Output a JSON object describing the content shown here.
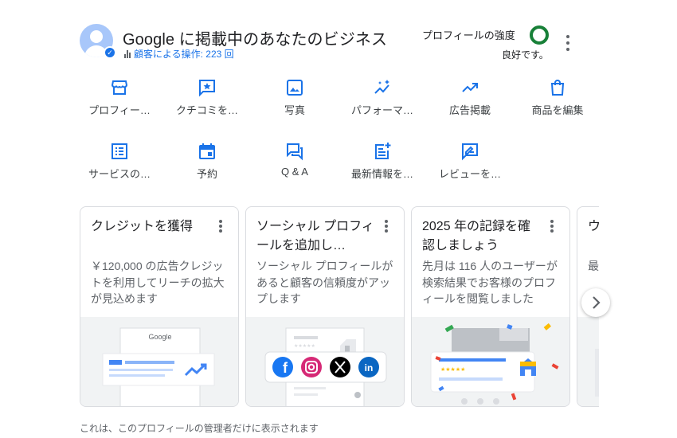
{
  "header": {
    "title": "Google に掲載中のあなたのビジネス",
    "interactions": "顧客による操作: 223 回",
    "profile_strength_label": "プロフィールの強度",
    "profile_strength_status": "良好です。",
    "accent_color": "#1a73e8",
    "strength_color": "#188038"
  },
  "actions": [
    {
      "icon": "storefront-icon",
      "label": "プロフィー…"
    },
    {
      "icon": "review-star-icon",
      "label": "クチコミを…"
    },
    {
      "icon": "photo-icon",
      "label": "写真"
    },
    {
      "icon": "performance-sparkle-icon",
      "label": "パフォーマ…"
    },
    {
      "icon": "trending-up-icon",
      "label": "広告掲載"
    },
    {
      "icon": "shopping-bag-icon",
      "label": "商品を編集"
    },
    {
      "icon": "services-list-icon",
      "label": "サービスの…"
    },
    {
      "icon": "calendar-icon",
      "label": "予約"
    },
    {
      "icon": "qa-chat-icon",
      "label": "Q & A"
    },
    {
      "icon": "add-post-icon",
      "label": "最新情報を…"
    },
    {
      "icon": "review-edit-icon",
      "label": "レビューを…"
    }
  ],
  "cards": [
    {
      "title": "クレジットを獲得",
      "body": "￥120,000 の広告クレジットを利用してリーチの拡大が見込めます",
      "illus_text": "Google"
    },
    {
      "title": "ソーシャル プロフィールを追加し…",
      "body": "ソーシャル プロフィールがあると顧客の信頼度がアップします"
    },
    {
      "title": "2025 年の記録を確認しましょう",
      "body": "先月は 116 人のユーザーが検索結果でお客様のプロフィールを閲覧しました"
    },
    {
      "title": "ウ図",
      "body": "最ら"
    }
  ],
  "next_icon": "chevron-right-icon",
  "footer": "これは、このプロフィールの管理者だけに表示されます"
}
